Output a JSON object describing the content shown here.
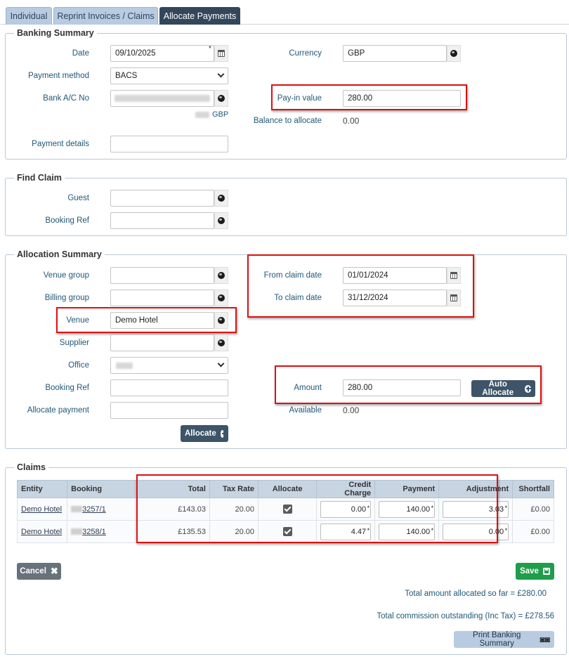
{
  "tabs": [
    {
      "label": "Individual"
    },
    {
      "label": "Reprint Invoices / Claims"
    },
    {
      "label": "Allocate Payments"
    }
  ],
  "banking_summary": {
    "legend": "Banking Summary",
    "date_label": "Date",
    "date_value": "09/10/2025",
    "payment_method_label": "Payment method",
    "payment_method_value": "BACS",
    "bank_label": "Bank A/C No",
    "bank_currency": "GBP",
    "payment_details_label": "Payment details",
    "currency_label": "Currency",
    "currency_value": "GBP",
    "payin_label": "Pay-in value",
    "payin_value": "280.00",
    "balance_label": "Balance to allocate",
    "balance_value": "0.00"
  },
  "find_claim": {
    "legend": "Find Claim",
    "guest_label": "Guest",
    "booking_ref_label": "Booking Ref"
  },
  "allocation_summary": {
    "legend": "Allocation Summary",
    "venue_group_label": "Venue group",
    "billing_group_label": "Billing group",
    "venue_label": "Venue",
    "venue_value": "Demo Hotel",
    "supplier_label": "Supplier",
    "office_label": "Office",
    "booking_ref_label": "Booking Ref",
    "allocate_payment_label": "Allocate payment",
    "allocate_button": "Allocate",
    "from_label": "From claim date",
    "from_value": "01/01/2024",
    "to_label": "To claim date",
    "to_value": "31/12/2024",
    "amount_label": "Amount",
    "amount_value": "280.00",
    "auto_allocate_button": "Auto Allocate",
    "available_label": "Available",
    "available_value": "0.00"
  },
  "claims": {
    "legend": "Claims",
    "headers": [
      "Entity",
      "Booking",
      "Total",
      "Tax Rate",
      "Allocate",
      "Credit Charge",
      "Payment",
      "Adjustment",
      "Shortfall"
    ],
    "rows": [
      {
        "entity": "Demo Hotel",
        "booking": "3257/1",
        "total": "£143.03",
        "tax_rate": "20.00",
        "credit_charge": "0.00",
        "payment": "140.00",
        "adjustment": "3.03",
        "shortfall": "£0.00"
      },
      {
        "entity": "Demo Hotel",
        "booking": "3258/1",
        "total": "£135.53",
        "tax_rate": "20.00",
        "credit_charge": "4.47",
        "payment": "140.00",
        "adjustment": "0.00",
        "shortfall": "£0.00"
      }
    ],
    "cancel_button": "Cancel",
    "save_button": "Save",
    "total_allocated": "Total amount allocated so far = £280.00",
    "total_commission": "Total commission outstanding (Inc Tax) = £278.56",
    "print_button": "Print Banking Summary"
  },
  "colors": {
    "accent_dark": "#33475b",
    "highlight_red": "#dd1111",
    "save_green": "#1e9e4a"
  }
}
